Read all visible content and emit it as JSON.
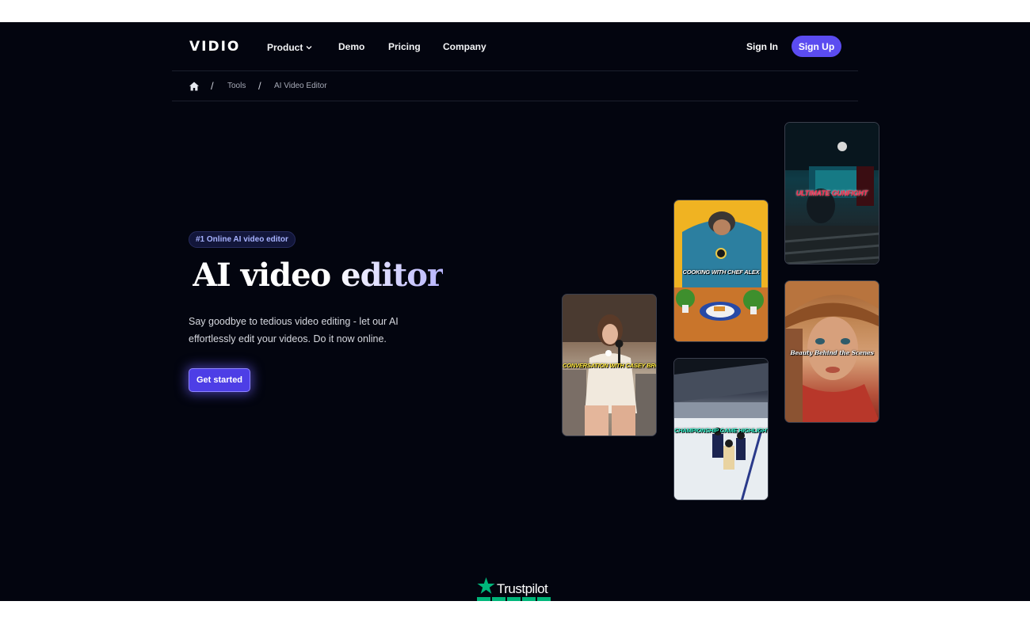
{
  "nav": {
    "logo": "VIDIO",
    "links": [
      {
        "label": "Product"
      },
      {
        "label": "Demo"
      },
      {
        "label": "Pricing"
      },
      {
        "label": "Company"
      }
    ],
    "sign_in": "Sign In",
    "sign_up": "Sign Up"
  },
  "breadcrumb": {
    "items": [
      "Tools",
      "AI Video Editor"
    ]
  },
  "hero": {
    "badge": "#1 Online AI video editor",
    "title": "AI video editor",
    "subtitle": "Say goodbye to tedious video editing - let our AI effortlessly edit your videos. Do it now online.",
    "cta": "Get started"
  },
  "cards": [
    {
      "caption": "CONVERSATION WITH CASEY BROWN"
    },
    {
      "caption": "COOKING WITH CHEF ALEX"
    },
    {
      "caption": "CHAMPIONSHIP GAME HIGHLIGHTS"
    },
    {
      "caption": "ULTIMATE GUNFIGHT"
    },
    {
      "caption": "Beauty Behind the Scenes"
    }
  ],
  "trustpilot": {
    "label": "Trustpilot"
  },
  "colors": {
    "background": "#03050f",
    "accent": "#5b4cf0",
    "trustpilot_green": "#00b67a"
  }
}
